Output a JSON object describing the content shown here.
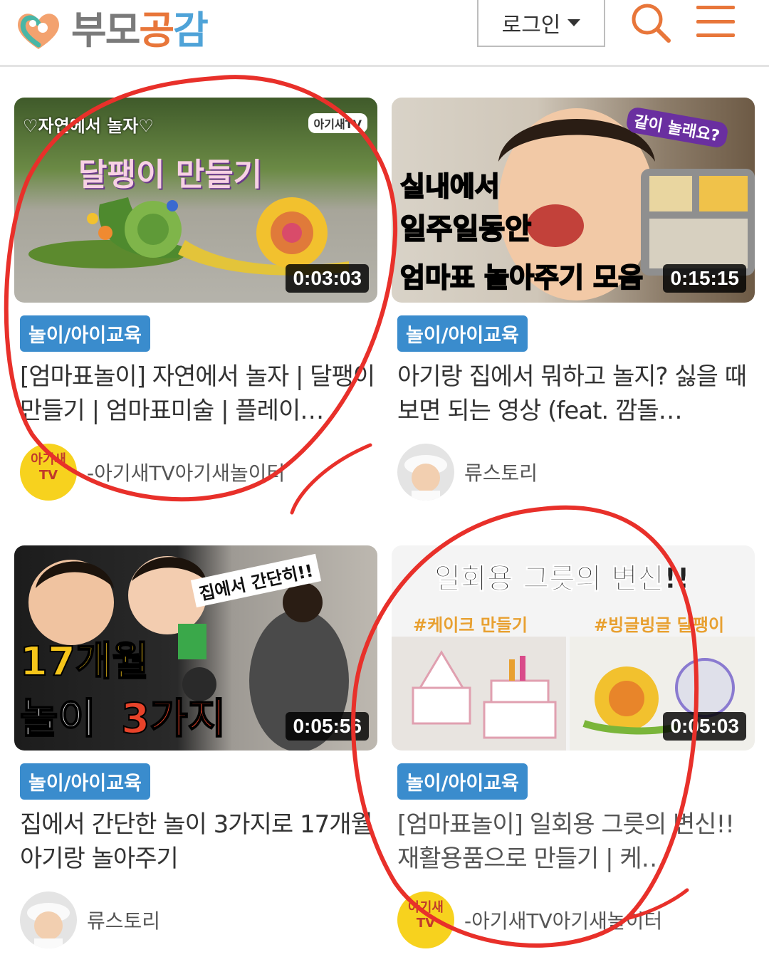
{
  "header": {
    "logo_text": [
      "부",
      "모",
      "공",
      "감"
    ],
    "logo_colors": [
      "#7a7a7a",
      "#7a7a7a",
      "#e8763a",
      "#4fa3d8"
    ],
    "login_label": "로그인",
    "search_icon": "search-icon",
    "menu_icon": "hamburger-menu-icon",
    "accent": "#e8763a"
  },
  "cards": [
    {
      "thumb_texts": [
        "♡자연에서 놀자♡",
        "아기새TV",
        "달팽이 만들기"
      ],
      "duration": "0:03:03",
      "badge": "놀이/아이교육",
      "title": "[엄마표놀이] 자연에서 놀자 | 달팽이 만들기 | 엄마표미술 | 플레이…",
      "channel": "-아기새TV아기새놀이터",
      "avatar_text": "아기새 TV"
    },
    {
      "thumb_texts": [
        "같이 놀래요?",
        "실내에서",
        "일주일동안",
        "엄마표 놀아주기 모음"
      ],
      "duration": "0:15:15",
      "badge": "놀이/아이교육",
      "title": "아기랑 집에서 뭐하고 놀지? 싫을 때 보면 되는 영상 (feat. 깜돌…",
      "channel": "류스토리",
      "avatar_text": ""
    },
    {
      "thumb_texts": [
        "집에서 간단히!!",
        "17개월",
        "놀이",
        "3가지"
      ],
      "duration": "0:05:56",
      "badge": "놀이/아이교육",
      "title": "집에서 간단한 놀이 3가지로 17개월 아기랑 놀아주기",
      "channel": "류스토리",
      "avatar_text": ""
    },
    {
      "thumb_texts": [
        "일회용 그릇의 변신!!",
        "#케이크 만들기",
        "#빙글빙글 달팽이"
      ],
      "duration": "0:05:03",
      "badge": "놀이/아이교육",
      "title": "[엄마표놀이] 일회용 그릇의 변신!! 재활용품으로 만들기 | 케…",
      "channel": "-아기새TV아기새놀이터",
      "avatar_text": "아기새 TV"
    }
  ],
  "colors": {
    "badge_bg": "#3a8ccd",
    "annotation": "#e8302a"
  }
}
